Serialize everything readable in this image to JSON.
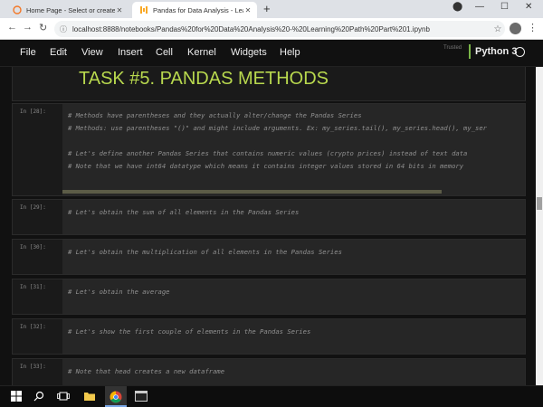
{
  "browser": {
    "tabs": [
      {
        "title": "Home Page - Select or create a n",
        "active": false
      },
      {
        "title": "Pandas for Data Analysis - Learn",
        "active": true
      }
    ],
    "url": "localhost:8888/notebooks/Pandas%20for%20Data%20Analysis%20-%20Learning%20Path%20Part%201.ipynb"
  },
  "jupyter": {
    "menu": [
      "File",
      "Edit",
      "View",
      "Insert",
      "Cell",
      "Kernel",
      "Widgets",
      "Help"
    ],
    "trusted": "Trusted",
    "kernel": "Python 3"
  },
  "notebook": {
    "heading": "TASK #5. PANDAS METHODS",
    "cells": [
      {
        "prompt": "In [28]:",
        "lines": [
          "# Methods have parentheses and they actually alter/change the Pandas Series",
          "# Methods: use parentheses \"()\" and might include arguments. Ex: my_series.tail(), my_series.head(), my_ser",
          "",
          "# Let's define another Pandas Series that contains numeric values (crypto prices) instead of text data",
          "# Note that we have int64 datatype which means it contains integer values stored in 64 bits in memory"
        ]
      },
      {
        "prompt": "In [29]:",
        "lines": [
          "# Let's obtain the sum of all elements in the Pandas Series"
        ]
      },
      {
        "prompt": "In [30]:",
        "lines": [
          "# Let's obtain the multiplication of all elements in the Pandas Series"
        ]
      },
      {
        "prompt": "In [31]:",
        "lines": [
          "# Let's obtain the average"
        ]
      },
      {
        "prompt": "In [32]:",
        "lines": [
          "# Let's show the first couple of elements in the Pandas Series"
        ]
      },
      {
        "prompt": "In [33]:",
        "lines": [
          "# Note that head creates a new dataframe"
        ]
      }
    ]
  },
  "colors": {
    "heading": "#b8d84e",
    "kernel_indicator": "#7ab648",
    "chrome_accent": "#1a73e8"
  },
  "icons": {
    "tab1": "jupyter-icon",
    "tab2": "pandas-icon",
    "taskbar": [
      "windows-start-icon",
      "search-icon",
      "task-view-icon",
      "file-explorer-icon",
      "chrome-icon",
      "terminal-icon"
    ]
  }
}
